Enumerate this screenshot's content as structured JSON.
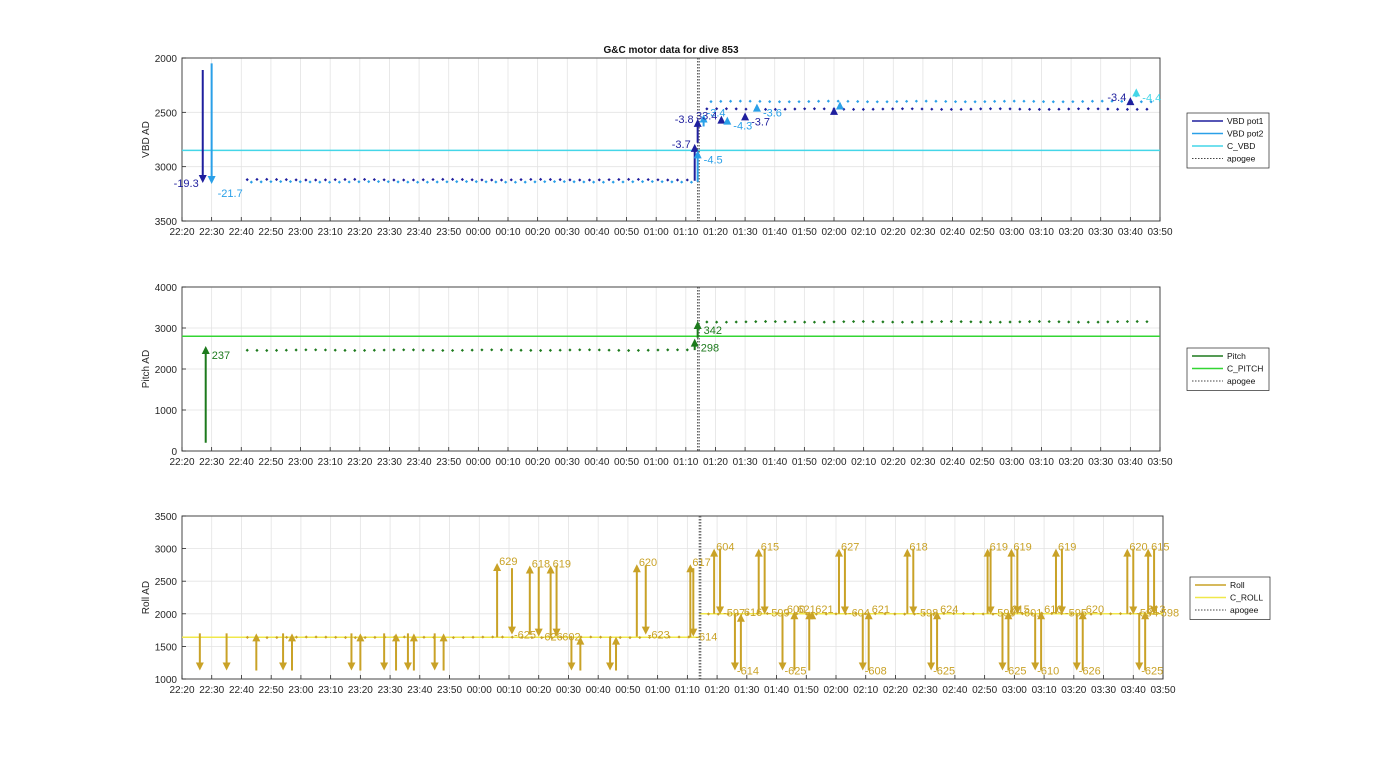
{
  "chart_data": [
    {
      "type": "line",
      "title": "G&C motor data for dive 853",
      "xlabel": "",
      "ylabel": "VBD AD",
      "ylim": [
        2000,
        3500
      ],
      "y_reversed": true,
      "yticks": [
        2000,
        2500,
        3000,
        3500
      ],
      "x_tick_labels": [
        "22:20",
        "22:30",
        "22:40",
        "22:50",
        "23:00",
        "23:10",
        "23:20",
        "23:30",
        "23:40",
        "23:50",
        "00:00",
        "00:10",
        "00:20",
        "00:30",
        "00:40",
        "00:50",
        "01:00",
        "01:10",
        "01:20",
        "01:30",
        "01:40",
        "01:50",
        "02:00",
        "02:10",
        "02:20",
        "02:30",
        "02:40",
        "02:50",
        "03:00",
        "03:10",
        "03:20",
        "03:30",
        "03:40",
        "03:50"
      ],
      "grid": true,
      "legend_position": "right",
      "legend": [
        {
          "label": "VBD pot1",
          "color": "#1f1f9e",
          "style": "solid"
        },
        {
          "label": "VBD pot2",
          "color": "#2aa0e8",
          "style": "solid"
        },
        {
          "label": "C_VBD",
          "color": "#44d6e8",
          "style": "solid"
        },
        {
          "label": "apogee",
          "color": "#444444",
          "style": "dotted"
        }
      ],
      "reference_lines": [
        {
          "name": "C_VBD",
          "y": 2850,
          "color": "#44d6e8"
        }
      ],
      "apogee_minute": 174,
      "series": [
        {
          "name": "VBD pot1",
          "color": "#1f1f9e",
          "values_before": 3120,
          "values_after": 2470
        },
        {
          "name": "VBD pot2",
          "color": "#2aa0e8",
          "values_before": 3140,
          "values_after": 2400
        }
      ],
      "arrows": [
        {
          "x_min": 7,
          "from": 2110,
          "to": 3150,
          "color": "#1f1f9e",
          "label": "-19.3",
          "label_side": "left"
        },
        {
          "x_min": 10,
          "from": 2050,
          "to": 3160,
          "color": "#2aa0e8",
          "label": "-21.7",
          "label_side": "right-below"
        },
        {
          "x_min": 173,
          "from": 3130,
          "to": 2790,
          "color": "#1f1f9e",
          "label": "-3.7",
          "label_side": "left"
        },
        {
          "x_min": 174,
          "from": 3140,
          "to": 2850,
          "color": "#2aa0e8",
          "label": "-4.5",
          "label_side": "right-below"
        },
        {
          "x_min": 174,
          "from": 2780,
          "to": 2560,
          "color": "#1f1f9e",
          "label": "-3.8",
          "label_side": "left"
        },
        {
          "x_min": 176,
          "from": 2630,
          "to": 2520,
          "color": "#2aa0e8",
          "label": "-3.4",
          "label_side": "right"
        },
        {
          "x_min": 182,
          "from": 2600,
          "to": 2530,
          "color": "#1f1f9e",
          "label": "33.4",
          "label_side": "left"
        },
        {
          "x_min": 184,
          "from": 2610,
          "to": 2540,
          "color": "#2aa0e8",
          "label": "-4.3",
          "label_side": "right-below"
        },
        {
          "x_min": 190,
          "from": 2560,
          "to": 2500,
          "color": "#1f1f9e",
          "label": "-3.7",
          "label_side": "right-below"
        },
        {
          "x_min": 194,
          "from": 2480,
          "to": 2420,
          "color": "#2aa0e8",
          "label": "-3.6",
          "label_side": "right-below"
        },
        {
          "x_min": 220,
          "from": 2500,
          "to": 2450,
          "color": "#1f1f9e",
          "label": "",
          "label_side": ""
        },
        {
          "x_min": 222,
          "from": 2450,
          "to": 2400,
          "color": "#2aa0e8",
          "label": "",
          "label_side": ""
        },
        {
          "x_min": 320,
          "from": 2430,
          "to": 2360,
          "color": "#1f1f9e",
          "label": "-3.4",
          "label_side": "left"
        },
        {
          "x_min": 322,
          "from": 2360,
          "to": 2280,
          "color": "#44d6e8",
          "label": "-4.4",
          "label_side": "right-below"
        }
      ]
    },
    {
      "type": "line",
      "title": "",
      "xlabel": "",
      "ylabel": "Pitch AD",
      "ylim": [
        0,
        4000
      ],
      "yticks": [
        0,
        1000,
        2000,
        3000,
        4000
      ],
      "x_tick_labels": [
        "22:20",
        "22:30",
        "22:40",
        "22:50",
        "23:00",
        "23:10",
        "23:20",
        "23:30",
        "23:40",
        "23:50",
        "00:00",
        "00:10",
        "00:20",
        "00:30",
        "00:40",
        "00:50",
        "01:00",
        "01:10",
        "01:20",
        "01:30",
        "01:40",
        "01:50",
        "02:00",
        "02:10",
        "02:20",
        "02:30",
        "02:40",
        "02:50",
        "03:00",
        "03:10",
        "03:20",
        "03:30",
        "03:40",
        "03:50"
      ],
      "grid": true,
      "legend_position": "right",
      "legend": [
        {
          "label": "Pitch",
          "color": "#1d7a1d",
          "style": "solid"
        },
        {
          "label": "C_PITCH",
          "color": "#33d633",
          "style": "solid"
        },
        {
          "label": "apogee",
          "color": "#444444",
          "style": "dotted"
        }
      ],
      "reference_lines": [
        {
          "name": "C_PITCH",
          "y": 2800,
          "color": "#33d633"
        }
      ],
      "apogee_minute": 174,
      "series": [
        {
          "name": "Pitch",
          "color": "#1d7a1d",
          "values_before": 2460,
          "values_after": 3150
        }
      ],
      "arrows": [
        {
          "x_min": 8,
          "from": 200,
          "to": 2560,
          "color": "#1d7a1d",
          "label": "237",
          "label_side": "right-below"
        },
        {
          "x_min": 173,
          "from": 2460,
          "to": 2740,
          "color": "#1d7a1d",
          "label": "298",
          "label_side": "right-below"
        },
        {
          "x_min": 174,
          "from": 2760,
          "to": 3170,
          "color": "#1d7a1d",
          "label": "342",
          "label_side": "right-below"
        }
      ]
    },
    {
      "type": "line",
      "title": "",
      "xlabel": "",
      "ylabel": "Roll AD",
      "ylim": [
        1000,
        3500
      ],
      "yticks": [
        1000,
        1500,
        2000,
        2500,
        3000,
        3500
      ],
      "x_tick_labels": [
        "22:20",
        "22:30",
        "22:40",
        "22:50",
        "23:00",
        "23:10",
        "23:20",
        "23:30",
        "23:40",
        "23:50",
        "00:00",
        "00:10",
        "00:20",
        "00:30",
        "00:40",
        "00:50",
        "01:00",
        "01:10",
        "01:20",
        "01:30",
        "01:40",
        "01:50",
        "02:00",
        "02:10",
        "02:20",
        "02:30",
        "02:40",
        "02:50",
        "03:00",
        "03:10",
        "03:20",
        "03:30",
        "03:40",
        "03:50"
      ],
      "grid": true,
      "legend_position": "right",
      "legend": [
        {
          "label": "Roll",
          "color": "#c9a227",
          "style": "solid"
        },
        {
          "label": "C_ROLL",
          "color": "#f0e84a",
          "style": "solid"
        },
        {
          "label": "apogee",
          "color": "#444444",
          "style": "dotted"
        }
      ],
      "reference_lines": [
        {
          "name": "C_ROLL",
          "y_before": 1640,
          "y_after": 2000,
          "color": "#f0e84a"
        }
      ],
      "apogee_minute": 174,
      "series": [
        {
          "name": "Roll",
          "color": "#c9a227",
          "values_before": 1640,
          "values_after": 2000
        }
      ],
      "arrows": [
        {
          "x_min": 6,
          "from": 1700,
          "to": 1130,
          "color": "#c9a227",
          "label": ""
        },
        {
          "x_min": 15,
          "from": 1700,
          "to": 1130,
          "color": "#c9a227",
          "label": ""
        },
        {
          "x_min": 25,
          "from": 1130,
          "to": 1700,
          "color": "#c9a227",
          "label": ""
        },
        {
          "x_min": 34,
          "from": 1700,
          "to": 1130,
          "color": "#c9a227",
          "label": ""
        },
        {
          "x_min": 37,
          "from": 1130,
          "to": 1700,
          "color": "#c9a227",
          "label": ""
        },
        {
          "x_min": 57,
          "from": 1700,
          "to": 1130,
          "color": "#c9a227",
          "label": ""
        },
        {
          "x_min": 60,
          "from": 1130,
          "to": 1700,
          "color": "#c9a227",
          "label": ""
        },
        {
          "x_min": 68,
          "from": 1700,
          "to": 1130,
          "color": "#c9a227",
          "label": ""
        },
        {
          "x_min": 72,
          "from": 1130,
          "to": 1700,
          "color": "#c9a227",
          "label": ""
        },
        {
          "x_min": 76,
          "from": 1700,
          "to": 1130,
          "color": "#c9a227",
          "label": ""
        },
        {
          "x_min": 78,
          "from": 1130,
          "to": 1700,
          "color": "#c9a227",
          "label": ""
        },
        {
          "x_min": 85,
          "from": 1700,
          "to": 1130,
          "color": "#c9a227",
          "label": ""
        },
        {
          "x_min": 88,
          "from": 1130,
          "to": 1700,
          "color": "#c9a227",
          "label": ""
        },
        {
          "x_min": 106,
          "from": 1640,
          "to": 2780,
          "color": "#c9a227",
          "label": "629",
          "label_side": "right-top"
        },
        {
          "x_min": 111,
          "from": 2700,
          "to": 1680,
          "color": "#c9a227",
          "label": "-625",
          "label_side": "right-bottom"
        },
        {
          "x_min": 117,
          "from": 1680,
          "to": 2740,
          "color": "#c9a227",
          "label": "618",
          "label_side": "right-top"
        },
        {
          "x_min": 120,
          "from": 2720,
          "to": 1650,
          "color": "#c9a227",
          "label": "-626",
          "label_side": "right-bottom"
        },
        {
          "x_min": 124,
          "from": 1650,
          "to": 2740,
          "color": "#c9a227",
          "label": "619",
          "label_side": "right-top"
        },
        {
          "x_min": 126,
          "from": 2740,
          "to": 1650,
          "color": "#c9a227",
          "label": "-602",
          "label_side": "right-bottom"
        },
        {
          "x_min": 131,
          "from": 1650,
          "to": 1130,
          "color": "#c9a227",
          "label": ""
        },
        {
          "x_min": 134,
          "from": 1130,
          "to": 1650,
          "color": "#c9a227",
          "label": ""
        },
        {
          "x_min": 144,
          "from": 1650,
          "to": 1130,
          "color": "#c9a227",
          "label": ""
        },
        {
          "x_min": 146,
          "from": 1130,
          "to": 1650,
          "color": "#c9a227",
          "label": ""
        },
        {
          "x_min": 153,
          "from": 1650,
          "to": 2760,
          "color": "#c9a227",
          "label": "620",
          "label_side": "right-top"
        },
        {
          "x_min": 156,
          "from": 2740,
          "to": 1680,
          "color": "#c9a227",
          "label": "-623",
          "label_side": "right-bottom"
        },
        {
          "x_min": 171,
          "from": 1640,
          "to": 2760,
          "color": "#c9a227",
          "label": "617",
          "label_side": "right-top"
        },
        {
          "x_min": 172,
          "from": 2700,
          "to": 1650,
          "color": "#c9a227",
          "label": "-614",
          "label_side": "right-bottom"
        },
        {
          "x_min": 179,
          "from": 2000,
          "to": 3000,
          "color": "#c9a227",
          "label": "604",
          "label_side": "right-top"
        },
        {
          "x_min": 181,
          "from": 3000,
          "to": 1990,
          "color": "#c9a227",
          "label": "-597",
          "label_side": "right"
        },
        {
          "x_min": 186,
          "from": 2000,
          "to": 1130,
          "color": "#c9a227",
          "label": "-614",
          "label_side": "right-bottom"
        },
        {
          "x_min": 188,
          "from": 1130,
          "to": 2000,
          "color": "#c9a227",
          "label": "616",
          "label_side": "right"
        },
        {
          "x_min": 194,
          "from": 2000,
          "to": 3000,
          "color": "#c9a227",
          "label": "615",
          "label_side": "right-top"
        },
        {
          "x_min": 196,
          "from": 3000,
          "to": 1990,
          "color": "#c9a227",
          "label": "-599",
          "label_side": "right"
        },
        {
          "x_min": 202,
          "from": 2000,
          "to": 1130,
          "color": "#c9a227",
          "label": "-625",
          "label_side": "right-bottom"
        },
        {
          "x_min": 206,
          "from": 1130,
          "to": 2040,
          "color": "#c9a227",
          "label": "621",
          "label_side": "right"
        },
        {
          "x_min": 211,
          "from": 1130,
          "to": 2040,
          "color": "#c9a227",
          "label": "-600",
          "label_side": "left-bottom"
        },
        {
          "x_min": 212,
          "from": 2040,
          "to": 2040,
          "color": "#c9a227",
          "label": "621",
          "label_side": "right"
        },
        {
          "x_min": 221,
          "from": 2000,
          "to": 3000,
          "color": "#c9a227",
          "label": "627",
          "label_side": "right-top"
        },
        {
          "x_min": 223,
          "from": 3000,
          "to": 1990,
          "color": "#c9a227",
          "label": "-604",
          "label_side": "right"
        },
        {
          "x_min": 229,
          "from": 2000,
          "to": 1130,
          "color": "#c9a227",
          "label": "-608",
          "label_side": "right-bottom"
        },
        {
          "x_min": 231,
          "from": 1130,
          "to": 2040,
          "color": "#c9a227",
          "label": "621",
          "label_side": "right"
        },
        {
          "x_min": 244,
          "from": 2000,
          "to": 3000,
          "color": "#c9a227",
          "label": "618",
          "label_side": "right-top"
        },
        {
          "x_min": 246,
          "from": 3000,
          "to": 1990,
          "color": "#c9a227",
          "label": "-598",
          "label_side": "right"
        },
        {
          "x_min": 252,
          "from": 2000,
          "to": 1130,
          "color": "#c9a227",
          "label": "-625",
          "label_side": "right-bottom"
        },
        {
          "x_min": 254,
          "from": 1130,
          "to": 2040,
          "color": "#c9a227",
          "label": "624",
          "label_side": "right"
        },
        {
          "x_min": 271,
          "from": 2000,
          "to": 3000,
          "color": "#c9a227",
          "label": "619",
          "label_side": "right-top"
        },
        {
          "x_min": 272,
          "from": 3000,
          "to": 1990,
          "color": "#c9a227",
          "label": "-599",
          "label_side": "right"
        },
        {
          "x_min": 276,
          "from": 2000,
          "to": 1130,
          "color": "#c9a227",
          "label": "-625",
          "label_side": "right-bottom"
        },
        {
          "x_min": 278,
          "from": 1130,
          "to": 2040,
          "color": "#c9a227",
          "label": "615",
          "label_side": "right"
        },
        {
          "x_min": 279,
          "from": 2000,
          "to": 3000,
          "color": "#c9a227",
          "label": "619",
          "label_side": "right-top"
        },
        {
          "x_min": 281,
          "from": 3000,
          "to": 1990,
          "color": "#c9a227",
          "label": "-601",
          "label_side": "right"
        },
        {
          "x_min": 287,
          "from": 2000,
          "to": 1130,
          "color": "#c9a227",
          "label": "-610",
          "label_side": "right-bottom"
        },
        {
          "x_min": 289,
          "from": 1130,
          "to": 2040,
          "color": "#c9a227",
          "label": "616",
          "label_side": "right"
        },
        {
          "x_min": 294,
          "from": 2000,
          "to": 3000,
          "color": "#c9a227",
          "label": "619",
          "label_side": "right-top"
        },
        {
          "x_min": 296,
          "from": 3000,
          "to": 1990,
          "color": "#c9a227",
          "label": "-595",
          "label_side": "right"
        },
        {
          "x_min": 301,
          "from": 2000,
          "to": 1130,
          "color": "#c9a227",
          "label": "-626",
          "label_side": "right-bottom"
        },
        {
          "x_min": 303,
          "from": 1130,
          "to": 2040,
          "color": "#c9a227",
          "label": "620",
          "label_side": "right"
        },
        {
          "x_min": 318,
          "from": 2000,
          "to": 3000,
          "color": "#c9a227",
          "label": "620",
          "label_side": "right-top"
        },
        {
          "x_min": 320,
          "from": 3000,
          "to": 1990,
          "color": "#c9a227",
          "label": "-594",
          "label_side": "right"
        },
        {
          "x_min": 322,
          "from": 2000,
          "to": 1130,
          "color": "#c9a227",
          "label": "-625",
          "label_side": "right-bottom"
        },
        {
          "x_min": 324,
          "from": 1130,
          "to": 2040,
          "color": "#c9a227",
          "label": "613",
          "label_side": "right-top"
        },
        {
          "x_min": 325,
          "from": 2000,
          "to": 3000,
          "color": "#c9a227",
          "label": "615",
          "label_side": "right"
        },
        {
          "x_min": 327,
          "from": 3000,
          "to": 1990,
          "color": "#c9a227",
          "label": "-598",
          "label_side": "right"
        }
      ]
    }
  ]
}
